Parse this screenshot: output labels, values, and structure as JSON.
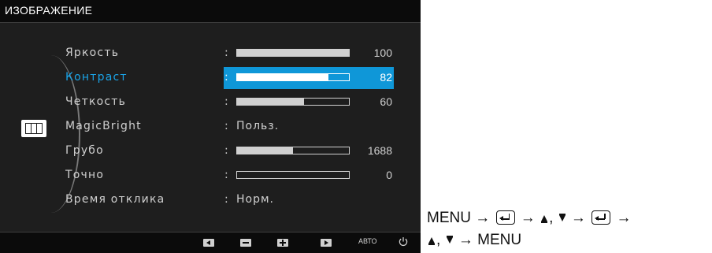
{
  "osd": {
    "title": "ИЗОБРАЖЕНИЕ",
    "side_icon": "picture-mode-icon",
    "rows": [
      {
        "label": "Яркость",
        "colon": ":",
        "type": "bar",
        "value": 100,
        "max": 100,
        "value_label": "100",
        "selected": false
      },
      {
        "label": "Контраст",
        "colon": ":",
        "type": "bar",
        "value": 82,
        "max": 100,
        "value_label": "82",
        "selected": true
      },
      {
        "label": "Четкость",
        "colon": ":",
        "type": "bar",
        "value": 60,
        "max": 100,
        "value_label": "60",
        "selected": false
      },
      {
        "label": "MagicBright",
        "colon": ":",
        "type": "text",
        "text": "Польз.",
        "selected": false
      },
      {
        "label": "Грубо",
        "colon": ":",
        "type": "bar",
        "value": 0.5,
        "max": 1,
        "value_label": "1688",
        "selected": false
      },
      {
        "label": "Точно",
        "colon": ":",
        "type": "bar",
        "value": 0,
        "max": 100,
        "value_label": "0",
        "selected": false
      },
      {
        "label": "Время отклика",
        "colon": ":",
        "type": "text",
        "text": "Норм.",
        "selected": false
      }
    ],
    "bottom_buttons": [
      {
        "icon": "left-arrow-icon"
      },
      {
        "icon": "minus-icon"
      },
      {
        "icon": "plus-icon"
      },
      {
        "icon": "right-arrow-icon"
      }
    ],
    "auto_label": "АВТО",
    "power_icon": "power-icon"
  },
  "caption": {
    "line1_menu": "MENU",
    "line1_arrow": "→",
    "line1_sep": ",",
    "line2_sep": ",",
    "line2_end": "MENU"
  },
  "colors": {
    "osd_bg": "#1e1e1e",
    "title_bg": "#0b0b0b",
    "highlight": "#0f97d8",
    "selected_label": "#1aa4e8"
  }
}
